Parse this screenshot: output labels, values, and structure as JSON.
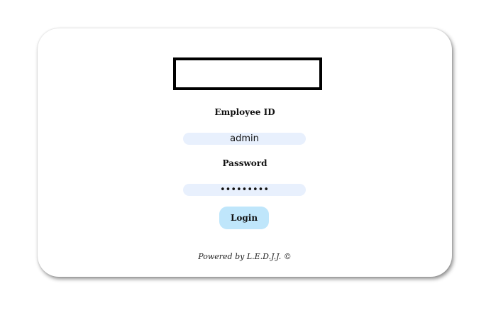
{
  "login": {
    "employee_id_label": "Employee ID",
    "employee_id_value": "admin",
    "password_label": "Password",
    "password_value": "•••••••••",
    "login_button": "Login",
    "footer": "Powered by L.E.D.J.J. ©"
  },
  "colors": {
    "input_background": "#e8f0fd",
    "button_background": "#bfe6fb",
    "logo_border": "#000000"
  }
}
